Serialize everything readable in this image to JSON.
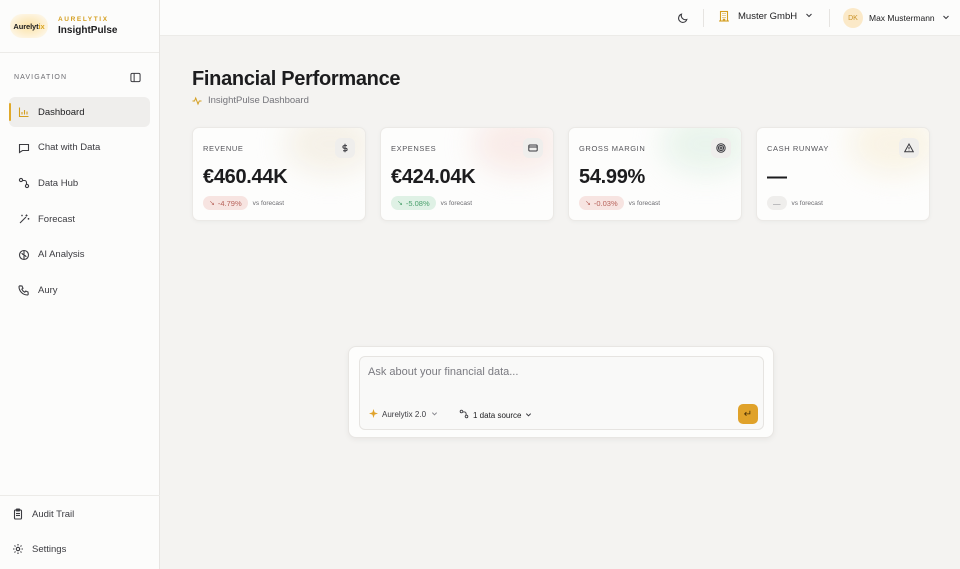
{
  "brand": {
    "logo_text": "Aurelyt",
    "logo_accent": "ix",
    "sup": "AURELYTIX",
    "name": "InsightPulse"
  },
  "navigation": {
    "heading": "NAVIGATION",
    "items": [
      {
        "label": "Dashboard",
        "icon": "bar-chart-icon",
        "active": true
      },
      {
        "label": "Chat with Data",
        "icon": "chat-bubble-icon"
      },
      {
        "label": "Data Hub",
        "icon": "data-hub-icon"
      },
      {
        "label": "Forecast",
        "icon": "wand-icon"
      },
      {
        "label": "AI Analysis",
        "icon": "brain-icon"
      },
      {
        "label": "Aury",
        "icon": "phone-icon"
      }
    ],
    "bottom": [
      {
        "label": "Audit Trail",
        "icon": "clipboard-icon"
      },
      {
        "label": "Settings",
        "icon": "gear-icon"
      }
    ]
  },
  "topbar": {
    "org": "Muster GmbH",
    "user_initials": "DK",
    "user_name": "Max Mustermann"
  },
  "page": {
    "title": "Financial Performance",
    "subtitle": "InsightPulse Dashboard"
  },
  "kpis": [
    {
      "label": "REVENUE",
      "value": "€460.44K",
      "delta": "-4.79%",
      "trend": "down",
      "note": "vs forecast",
      "icon": "dollar-icon",
      "glow": "#f1ede4"
    },
    {
      "label": "EXPENSES",
      "value": "€424.04K",
      "delta": "-5.08%",
      "trend": "down-good",
      "note": "vs forecast",
      "icon": "credit-card-icon",
      "glow": "#f6e3df"
    },
    {
      "label": "GROSS MARGIN",
      "value": "54.99%",
      "delta": "-0.03%",
      "trend": "down",
      "note": "vs forecast",
      "icon": "target-icon",
      "glow": "#e1f0e6"
    },
    {
      "label": "CASH RUNWAY",
      "value": "—",
      "delta": "—",
      "trend": "none",
      "note": "vs forecast",
      "icon": "warning-icon",
      "glow": "#f7efd9"
    }
  ],
  "chat": {
    "placeholder": "Ask about your financial data...",
    "model": "Aurelytix 2.0",
    "sources": "1 data source",
    "send_glyph": "↵"
  },
  "colors": {
    "accent": "#e0a22a",
    "negative_bg": "#f7e4e1",
    "positive_bg": "#dff1e5"
  }
}
